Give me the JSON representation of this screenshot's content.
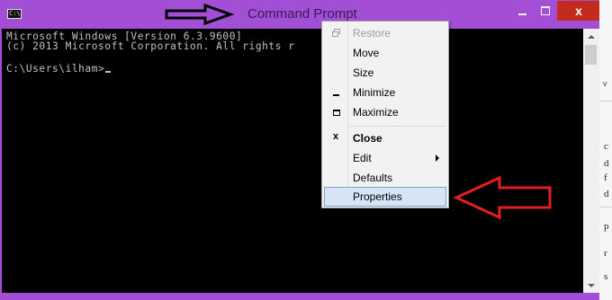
{
  "window": {
    "title": "Command Prompt",
    "icon_label": "C:\\",
    "close_glyph": "x"
  },
  "console": {
    "lines": [
      "Microsoft Windows [Version 6.3.9600]",
      "(c) 2013 Microsoft Corporation. All rights r",
      "",
      "C:\\Users\\ilham>"
    ]
  },
  "system_menu": {
    "items": [
      {
        "label": "Restore",
        "icon": "restore-icon",
        "state": "disabled"
      },
      {
        "label": "Move",
        "icon": "",
        "state": "normal"
      },
      {
        "label": "Size",
        "icon": "",
        "state": "normal"
      },
      {
        "label": "Minimize",
        "icon": "minimize-icon",
        "state": "normal"
      },
      {
        "label": "Maximize",
        "icon": "maximize-icon",
        "state": "normal"
      },
      {
        "label": "Close",
        "icon": "close-icon",
        "state": "bold"
      },
      {
        "label": "Edit",
        "icon": "",
        "state": "submenu"
      },
      {
        "label": "Defaults",
        "icon": "",
        "state": "normal"
      },
      {
        "label": "Properties",
        "icon": "",
        "state": "highlighted"
      }
    ],
    "close_icon_glyph": "x"
  },
  "background_doc": {
    "chevron": "v",
    "fragments": [
      "c",
      "d",
      "f",
      "d",
      "p",
      "r",
      "s"
    ]
  },
  "colors": {
    "frame": "#a24fd6",
    "console_bg": "#000000",
    "console_text": "#c0c0c0",
    "close_button": "#c42b1c",
    "menu_highlight": "#d5e5f6",
    "annotation_red": "#e02020"
  }
}
